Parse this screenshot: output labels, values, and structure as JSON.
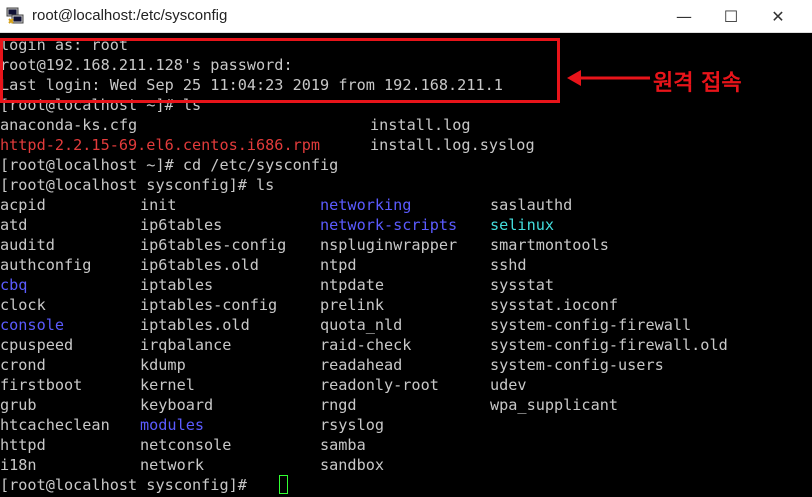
{
  "window": {
    "title": "root@localhost:/etc/sysconfig",
    "icon": "putty-icon",
    "controls": {
      "minimize": "—",
      "maximize": "☐",
      "close": "✕"
    }
  },
  "terminal": {
    "lines": [
      [
        {
          "t": "login as: root",
          "c": "white"
        }
      ],
      [
        {
          "t": "root@192.168.211.128's password:",
          "c": "white"
        }
      ],
      [
        {
          "t": "Last login: Wed Sep 25 11:04:23 2019 from 192.168.211.1",
          "c": "white"
        }
      ],
      [
        {
          "t": "[root@localhost ~]# ls",
          "c": "white"
        }
      ],
      [
        {
          "t": "anaconda-ks.cfg",
          "c": "white"
        },
        {
          "t": "install.log",
          "c": "white",
          "col": 370
        }
      ],
      [
        {
          "t": "httpd-2.2.15-69.el6.centos.i686.rpm",
          "c": "red"
        },
        {
          "t": "install.log.syslog",
          "c": "white",
          "col": 370
        }
      ],
      [
        {
          "t": "[root@localhost ~]# cd /etc/sysconfig",
          "c": "white"
        }
      ],
      [
        {
          "t": "[root@localhost sysconfig]# ls",
          "c": "white"
        }
      ],
      [
        {
          "t": "acpid",
          "c": "white"
        },
        {
          "t": "init",
          "c": "white",
          "col": 140
        },
        {
          "t": "networking",
          "c": "blue",
          "col": 320
        },
        {
          "t": "saslauthd",
          "c": "white",
          "col": 490
        }
      ],
      [
        {
          "t": "atd",
          "c": "white"
        },
        {
          "t": "ip6tables",
          "c": "white",
          "col": 140
        },
        {
          "t": "network-scripts",
          "c": "blue",
          "col": 320
        },
        {
          "t": "selinux",
          "c": "cyan",
          "col": 490
        }
      ],
      [
        {
          "t": "auditd",
          "c": "white"
        },
        {
          "t": "ip6tables-config",
          "c": "white",
          "col": 140
        },
        {
          "t": "nspluginwrapper",
          "c": "white",
          "col": 320
        },
        {
          "t": "smartmontools",
          "c": "white",
          "col": 490
        }
      ],
      [
        {
          "t": "authconfig",
          "c": "white"
        },
        {
          "t": "ip6tables.old",
          "c": "white",
          "col": 140
        },
        {
          "t": "ntpd",
          "c": "white",
          "col": 320
        },
        {
          "t": "sshd",
          "c": "white",
          "col": 490
        }
      ],
      [
        {
          "t": "cbq",
          "c": "blue"
        },
        {
          "t": "iptables",
          "c": "white",
          "col": 140
        },
        {
          "t": "ntpdate",
          "c": "white",
          "col": 320
        },
        {
          "t": "sysstat",
          "c": "white",
          "col": 490
        }
      ],
      [
        {
          "t": "clock",
          "c": "white"
        },
        {
          "t": "iptables-config",
          "c": "white",
          "col": 140
        },
        {
          "t": "prelink",
          "c": "white",
          "col": 320
        },
        {
          "t": "sysstat.ioconf",
          "c": "white",
          "col": 490
        }
      ],
      [
        {
          "t": "console",
          "c": "blue"
        },
        {
          "t": "iptables.old",
          "c": "white",
          "col": 140
        },
        {
          "t": "quota_nld",
          "c": "white",
          "col": 320
        },
        {
          "t": "system-config-firewall",
          "c": "white",
          "col": 490
        }
      ],
      [
        {
          "t": "cpuspeed",
          "c": "white"
        },
        {
          "t": "irqbalance",
          "c": "white",
          "col": 140
        },
        {
          "t": "raid-check",
          "c": "white",
          "col": 320
        },
        {
          "t": "system-config-firewall.old",
          "c": "white",
          "col": 490
        }
      ],
      [
        {
          "t": "crond",
          "c": "white"
        },
        {
          "t": "kdump",
          "c": "white",
          "col": 140
        },
        {
          "t": "readahead",
          "c": "white",
          "col": 320
        },
        {
          "t": "system-config-users",
          "c": "white",
          "col": 490
        }
      ],
      [
        {
          "t": "firstboot",
          "c": "white"
        },
        {
          "t": "kernel",
          "c": "white",
          "col": 140
        },
        {
          "t": "readonly-root",
          "c": "white",
          "col": 320
        },
        {
          "t": "udev",
          "c": "white",
          "col": 490
        }
      ],
      [
        {
          "t": "grub",
          "c": "white"
        },
        {
          "t": "keyboard",
          "c": "white",
          "col": 140
        },
        {
          "t": "rngd",
          "c": "white",
          "col": 320
        },
        {
          "t": "wpa_supplicant",
          "c": "white",
          "col": 490
        }
      ],
      [
        {
          "t": "htcacheclean",
          "c": "white"
        },
        {
          "t": "modules",
          "c": "blue",
          "col": 140
        },
        {
          "t": "rsyslog",
          "c": "white",
          "col": 320
        }
      ],
      [
        {
          "t": "httpd",
          "c": "white"
        },
        {
          "t": "netconsole",
          "c": "white",
          "col": 140
        },
        {
          "t": "samba",
          "c": "white",
          "col": 320
        }
      ],
      [
        {
          "t": "i18n",
          "c": "white"
        },
        {
          "t": "network",
          "c": "white",
          "col": 140
        },
        {
          "t": "sandbox",
          "c": "white",
          "col": 320
        }
      ],
      [
        {
          "t": "[root@localhost sysconfig]# ",
          "c": "white"
        }
      ]
    ]
  },
  "annotation": {
    "text": "원격 접속",
    "color": "#e8141a"
  },
  "colors": {
    "background": "#000000",
    "text": "#c8c8c8",
    "red": "#e23b3b",
    "blue": "#5b5bff",
    "cyan": "#44dddd",
    "cursor": "#33ff33"
  }
}
